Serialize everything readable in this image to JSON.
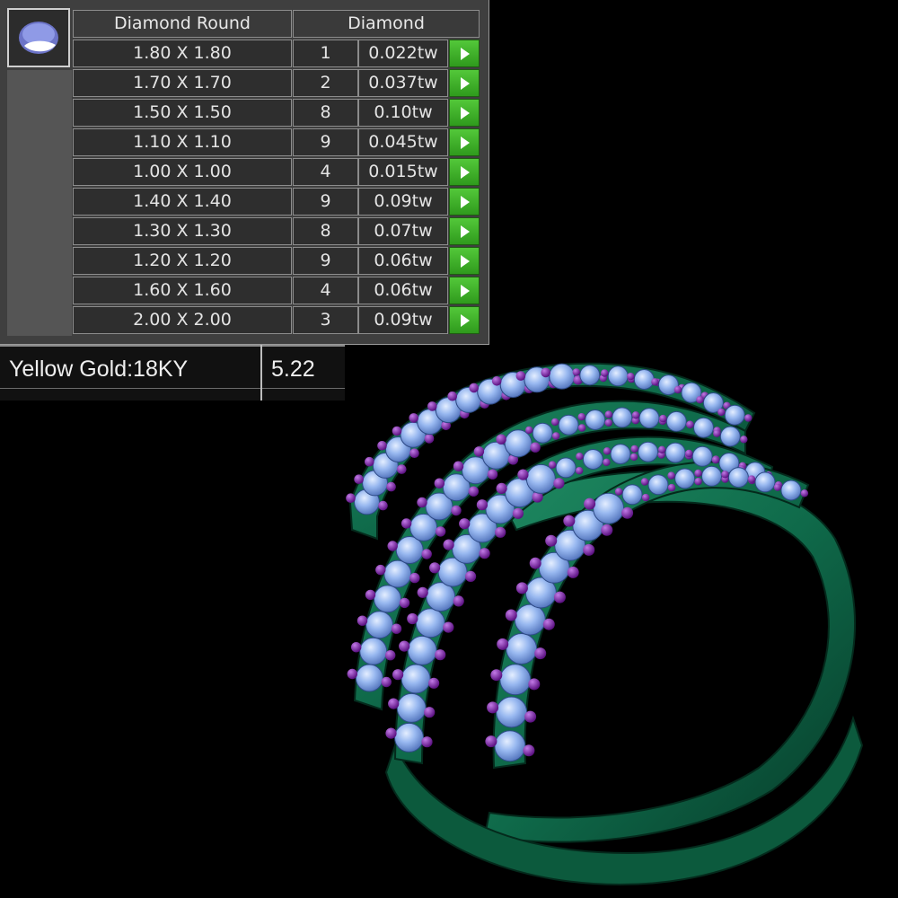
{
  "table": {
    "header_shape": "Diamond Round",
    "header_stone": "Diamond",
    "thumbnail_icon": "round-diamond-icon",
    "rows": [
      {
        "size": "1.80 X 1.80",
        "qty": "1",
        "weight": "0.022tw"
      },
      {
        "size": "1.70 X 1.70",
        "qty": "2",
        "weight": "0.037tw"
      },
      {
        "size": "1.50 X 1.50",
        "qty": "8",
        "weight": "0.10tw"
      },
      {
        "size": "1.10 X 1.10",
        "qty": "9",
        "weight": "0.045tw"
      },
      {
        "size": "1.00 X 1.00",
        "qty": "4",
        "weight": "0.015tw"
      },
      {
        "size": "1.40 X 1.40",
        "qty": "9",
        "weight": "0.09tw"
      },
      {
        "size": "1.30 X 1.30",
        "qty": "8",
        "weight": "0.07tw"
      },
      {
        "size": "1.20 X 1.20",
        "qty": "9",
        "weight": "0.06tw"
      },
      {
        "size": "1.60 X 1.60",
        "qty": "4",
        "weight": "0.06tw"
      },
      {
        "size": "2.00 X 2.00",
        "qty": "3",
        "weight": "0.09tw"
      }
    ],
    "row_button_icon": "play-arrow-icon"
  },
  "metal": {
    "label": "Yellow Gold:18KY",
    "weight": "5.22"
  },
  "colors": {
    "ring_metal": "#0f6a4a",
    "stone": "#8fb2ee",
    "prong": "#7a1fa6",
    "button": "#3bb12a",
    "background": "#000000"
  }
}
